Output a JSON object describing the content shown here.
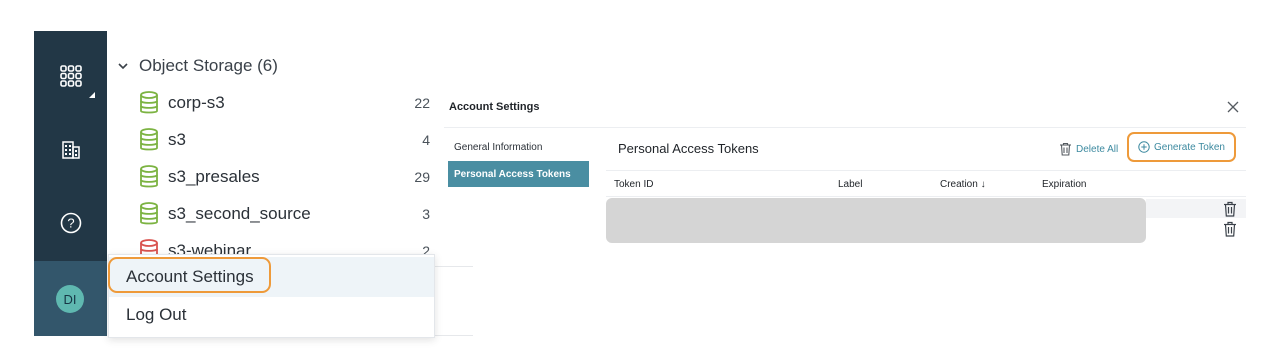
{
  "rail": {
    "apps_icon": "grid-icon",
    "building_icon": "building-icon",
    "help_icon": "help-icon",
    "avatar_initials": "DI"
  },
  "tree": {
    "header": "Object Storage (6)",
    "items": [
      {
        "name": "corp-s3",
        "count": "22",
        "status_color": "#7cb342"
      },
      {
        "name": "s3",
        "count": "4",
        "status_color": "#7cb342"
      },
      {
        "name": "s3_presales",
        "count": "29",
        "status_color": "#7cb342"
      },
      {
        "name": "s3_second_source",
        "count": "3",
        "status_color": "#7cb342"
      },
      {
        "name": "s3-webinar",
        "count": "2",
        "status_color": "#d9534f"
      }
    ]
  },
  "menu": {
    "items": [
      "Account Settings",
      "Log Out"
    ]
  },
  "settings": {
    "title": "Account Settings",
    "nav": [
      "General Information",
      "Personal Access Tokens"
    ],
    "section_title": "Personal Access Tokens",
    "delete_all": "Delete All",
    "generate_token": "Generate Token",
    "columns": [
      "Token ID",
      "Label",
      "Creation ↓",
      "Expiration"
    ],
    "highlight_color": "#ee9a3a",
    "accent_color": "#4a8ea2"
  }
}
